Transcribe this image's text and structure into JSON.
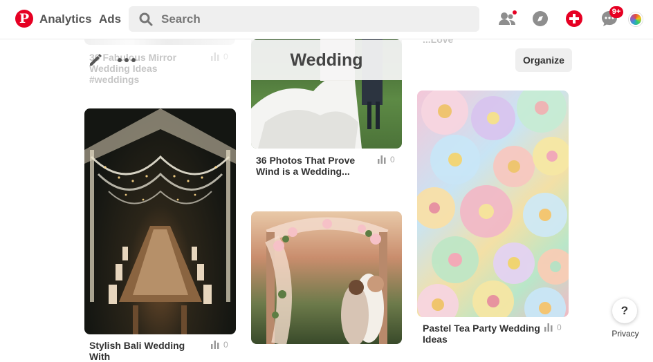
{
  "header": {
    "logo_letter": "P",
    "nav": {
      "analytics": "Analytics",
      "ads": "Ads"
    },
    "search": {
      "placeholder": "Search",
      "value": ""
    },
    "notifications_badge": "9+",
    "icons": [
      "search-icon",
      "people-icon",
      "compass-icon",
      "plus-icon",
      "chat-icon",
      "avatar"
    ]
  },
  "board": {
    "title": "Wedding",
    "organize_label": "Organize"
  },
  "pins": {
    "top_left": {
      "title": "30 Fabulous Mirror Wedding Ideas #weddings",
      "count": "0"
    },
    "venue": {
      "title": "Stylish Bali Wedding With",
      "count": "0"
    },
    "wind": {
      "title": "36 Photos That Prove Wind is a Wedding...",
      "count": "0"
    },
    "love": {
      "title": "...Love"
    },
    "flower": {
      "title": "Pastel Tea Party Wedding Ideas",
      "count": "0"
    }
  },
  "footer": {
    "help_label": "?",
    "privacy_label": "Privacy"
  },
  "colors": {
    "brand": "#e60023",
    "search_bg": "#efefef"
  }
}
